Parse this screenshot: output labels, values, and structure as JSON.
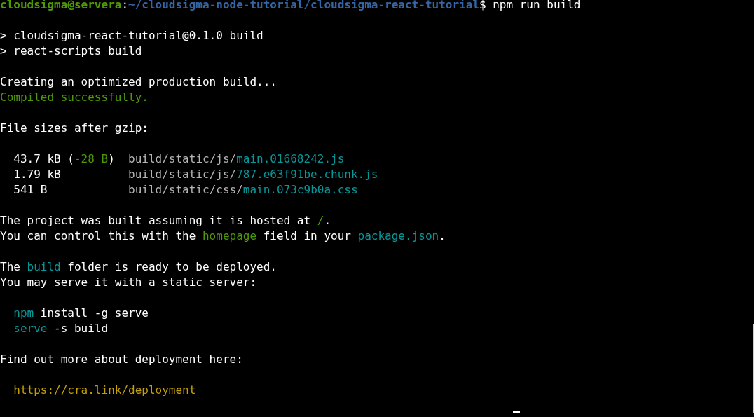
{
  "terminal": {
    "blocks": [
      {
        "indented": false,
        "lines": [
          [
            {
              "kind": "user",
              "text": "cloudsigma@servera"
            },
            {
              "kind": "plain",
              "text": ":"
            },
            {
              "kind": "path",
              "text": "~/cloudsigma-node-tutorial/cloudsigma-react-tutorial"
            },
            {
              "kind": "plain",
              "text": "$ npm run build"
            }
          ]
        ]
      },
      {
        "indented": false,
        "lines": [
          [
            {
              "kind": "plain",
              "text": "> cloudsigma-react-tutorial@0.1.0 build"
            }
          ],
          [
            {
              "kind": "plain",
              "text": "> react-scripts build"
            }
          ]
        ]
      },
      {
        "indented": false,
        "lines": [
          [
            {
              "kind": "plain",
              "text": "Creating an optimized production build..."
            }
          ],
          [
            {
              "kind": "green",
              "text": "Compiled successfully."
            }
          ]
        ]
      },
      {
        "indented": false,
        "lines": [
          [
            {
              "kind": "plain",
              "text": "File sizes after gzip:"
            }
          ]
        ]
      },
      {
        "indented": true,
        "lines": [
          [
            {
              "kind": "plain",
              "text": "43.7 kB ("
            },
            {
              "kind": "green",
              "text": "-28 B"
            },
            {
              "kind": "plain",
              "text": ")  "
            },
            {
              "kind": "dim",
              "text": "build/static/js/"
            },
            {
              "kind": "cyan",
              "text": "main.01668242.js"
            }
          ],
          [
            {
              "kind": "plain",
              "text": "1.79 kB          "
            },
            {
              "kind": "dim",
              "text": "build/static/js/"
            },
            {
              "kind": "cyan",
              "text": "787.e63f91be.chunk.js"
            }
          ],
          [
            {
              "kind": "plain",
              "text": "541 B            "
            },
            {
              "kind": "dim",
              "text": "build/static/css/"
            },
            {
              "kind": "cyan",
              "text": "main.073c9b0a.css"
            }
          ]
        ]
      },
      {
        "indented": false,
        "lines": [
          [
            {
              "kind": "plain",
              "text": "The project was built assuming it is hosted at "
            },
            {
              "kind": "green",
              "text": "/"
            },
            {
              "kind": "plain",
              "text": "."
            }
          ],
          [
            {
              "kind": "plain",
              "text": "You can control this with the "
            },
            {
              "kind": "green",
              "text": "homepage"
            },
            {
              "kind": "plain",
              "text": " field in your "
            },
            {
              "kind": "cyan",
              "text": "package.json"
            },
            {
              "kind": "plain",
              "text": "."
            }
          ]
        ]
      },
      {
        "indented": false,
        "lines": [
          [
            {
              "kind": "plain",
              "text": "The "
            },
            {
              "kind": "cyan",
              "text": "build"
            },
            {
              "kind": "plain",
              "text": " folder is ready to be deployed."
            }
          ],
          [
            {
              "kind": "plain",
              "text": "You may serve it with a static server:"
            }
          ]
        ]
      },
      {
        "indented": true,
        "lines": [
          [
            {
              "kind": "cyan",
              "text": "npm"
            },
            {
              "kind": "plain",
              "text": " install -g serve"
            }
          ],
          [
            {
              "kind": "cyan",
              "text": "serve"
            },
            {
              "kind": "plain",
              "text": " -s build"
            }
          ]
        ]
      },
      {
        "indented": false,
        "lines": [
          [
            {
              "kind": "plain",
              "text": "Find out more about deployment here:"
            }
          ]
        ]
      },
      {
        "indented": true,
        "lines": [
          [
            {
              "kind": "yellow",
              "text": "https://cra.link/deployment"
            }
          ]
        ]
      }
    ]
  }
}
